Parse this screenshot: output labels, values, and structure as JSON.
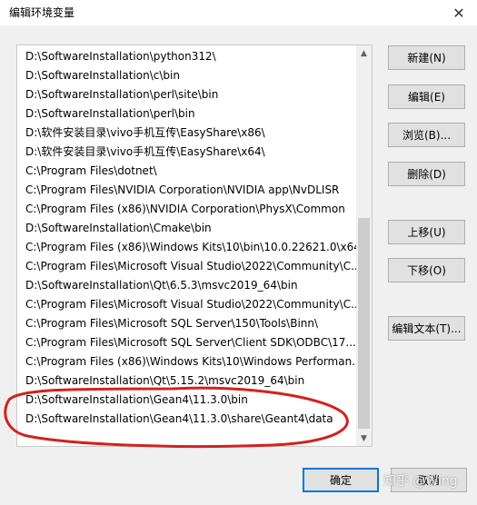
{
  "window": {
    "title": "编辑环境变量",
    "close_glyph": "✕"
  },
  "paths": [
    "D:\\SoftwareInstallation\\python312\\",
    "D:\\SoftwareInstallation\\c\\bin",
    "D:\\SoftwareInstallation\\perl\\site\\bin",
    "D:\\SoftwareInstallation\\perl\\bin",
    "D:\\软件安装目录\\vivo手机互传\\EasyShare\\x86\\",
    "D:\\软件安装目录\\vivo手机互传\\EasyShare\\x64\\",
    "C:\\Program Files\\dotnet\\",
    "C:\\Program Files\\NVIDIA Corporation\\NVIDIA app\\NvDLISR",
    "C:\\Program Files (x86)\\NVIDIA Corporation\\PhysX\\Common",
    "D:\\SoftwareInstallation\\Cmake\\bin",
    "C:\\Program Files (x86)\\Windows Kits\\10\\bin\\10.0.22621.0\\x64",
    "C:\\Program Files\\Microsoft Visual Studio\\2022\\Community\\C...",
    "D:\\SoftwareInstallation\\Qt\\6.5.3\\msvc2019_64\\bin",
    "C:\\Program Files\\Microsoft Visual Studio\\2022\\Community\\C...",
    "C:\\Program Files\\Microsoft SQL Server\\150\\Tools\\Binn\\",
    "C:\\Program Files\\Microsoft SQL Server\\Client SDK\\ODBC\\17...",
    "C:\\Program Files (x86)\\Windows Kits\\10\\Windows Performan...",
    "D:\\SoftwareInstallation\\Qt\\5.15.2\\msvc2019_64\\bin",
    "D:\\SoftwareInstallation\\Gean4\\11.3.0\\bin",
    "D:\\SoftwareInstallation\\Gean4\\11.3.0\\share\\Geant4\\data"
  ],
  "buttons": {
    "new": "新建(N)",
    "edit": "编辑(E)",
    "browse": "浏览(B)...",
    "delete": "删除(D)",
    "move_up": "上移(U)",
    "move_down": "下移(O)",
    "edit_text": "编辑文本(T)...",
    "ok": "确定",
    "cancel": "取消"
  },
  "scrollbar": {
    "up_glyph": "▲",
    "down_glyph": "▼"
  },
  "watermark": "知乎 @Wing",
  "colors": {
    "annotation": "#d42020",
    "default_button_border": "#0078d7"
  }
}
